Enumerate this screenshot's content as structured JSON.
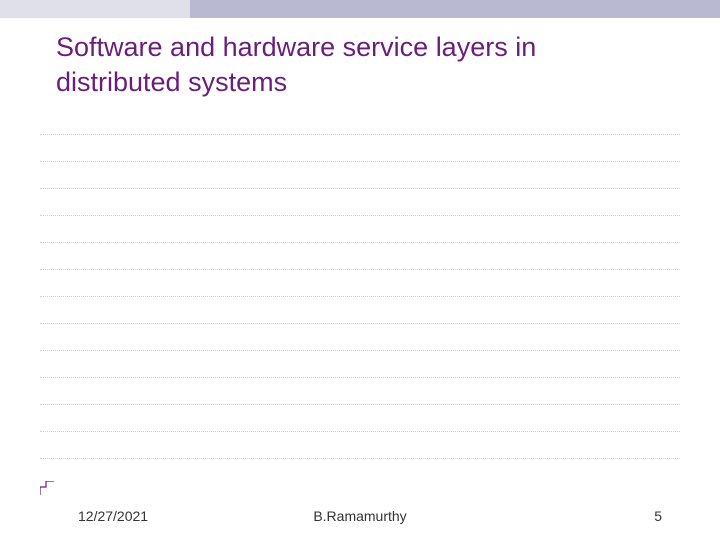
{
  "slide": {
    "title": "Software and hardware service layers in distributed systems"
  },
  "footer": {
    "date": "12/27/2021",
    "author": "B.Ramamurthy",
    "page": "5"
  }
}
